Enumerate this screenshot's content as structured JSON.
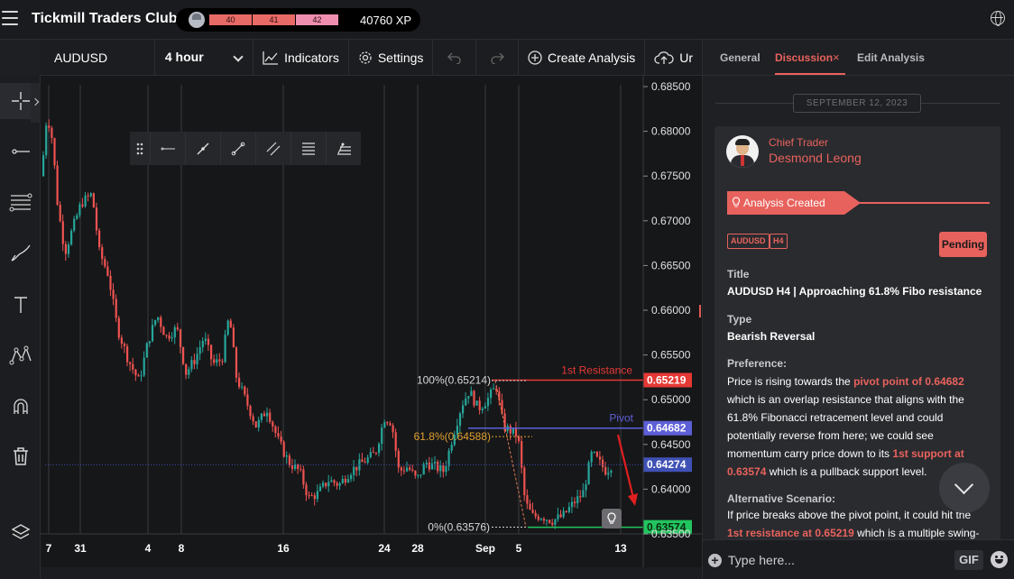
{
  "app": {
    "brand": "Tickmill Traders Club",
    "xp_levels": [
      "40",
      "41",
      "42"
    ],
    "xp_value": "40760 XP"
  },
  "toolbar": {
    "symbol": "AUDUSD",
    "timeframe": "4 hour",
    "indicators": "Indicators",
    "settings": "Settings",
    "create_analysis": "Create Analysis",
    "upload_partial": "Ur"
  },
  "chart": {
    "price_ticks": [
      "0.68500",
      "0.68000",
      "0.67500",
      "0.67000",
      "0.66500",
      "0.66000",
      "0.65500",
      "0.65000",
      "0.64500",
      "0.64000",
      "0.63500"
    ],
    "date_ticks": [
      "7",
      "31",
      "4",
      "8",
      "16",
      "24",
      "28",
      "Sep",
      "5",
      "13"
    ],
    "price_tags": {
      "resistance": "0.65219",
      "pivot": "0.64682",
      "current": "0.64274",
      "support": "0.63574"
    },
    "labels": {
      "first_resistance": "1st Resistance",
      "pivot": "Pivot",
      "fib_100": "100%(0.65214)",
      "fib_618": "61.8%(0.64588)",
      "fib_0": "0%(0.63576)"
    },
    "colors": {
      "up": "#26a69a",
      "down": "#ef5350",
      "resistance": "#e53935",
      "pivot": "#5c5fd6",
      "support": "#22c55e",
      "fib": "#e0a030",
      "current": "#3f51b5"
    }
  },
  "panel": {
    "tabs": {
      "general": "General",
      "discussion": "Discussion",
      "edit": "Edit Analysis"
    },
    "date": "SEPTEMBER 12, 2023",
    "role": "Chief Trader",
    "author": "Desmond Leong",
    "status": "Analysis Created",
    "tags": [
      "AUDUSD",
      "H4"
    ],
    "state": "Pending",
    "title_label": "Title",
    "title_value": "AUDUSD H4 | Approaching 61.8% Fibo resistance",
    "type_label": "Type",
    "type_value": "Bearish Reversal",
    "preference_label": "Preference:",
    "pref": {
      "p1": "Price is rising towards the ",
      "h1": "pivot point of 0.64682",
      "p2": " which is an overlap resistance that aligns with the 61.8% Fibonacci retracement level and could potentially reverse from here; we could see momentum carry price down to its ",
      "h2": "1st support at 0.63574",
      "p3": " which is a pullback support level."
    },
    "alt_label": "Alternative Scenario:",
    "alt": {
      "p1": "If price breaks above the pivot point, it could hit the ",
      "h1": "1st resistance at 0.65219",
      "p2": " which is a multiple swing-"
    },
    "composer_placeholder": "Type here...",
    "gif": "GIF"
  }
}
